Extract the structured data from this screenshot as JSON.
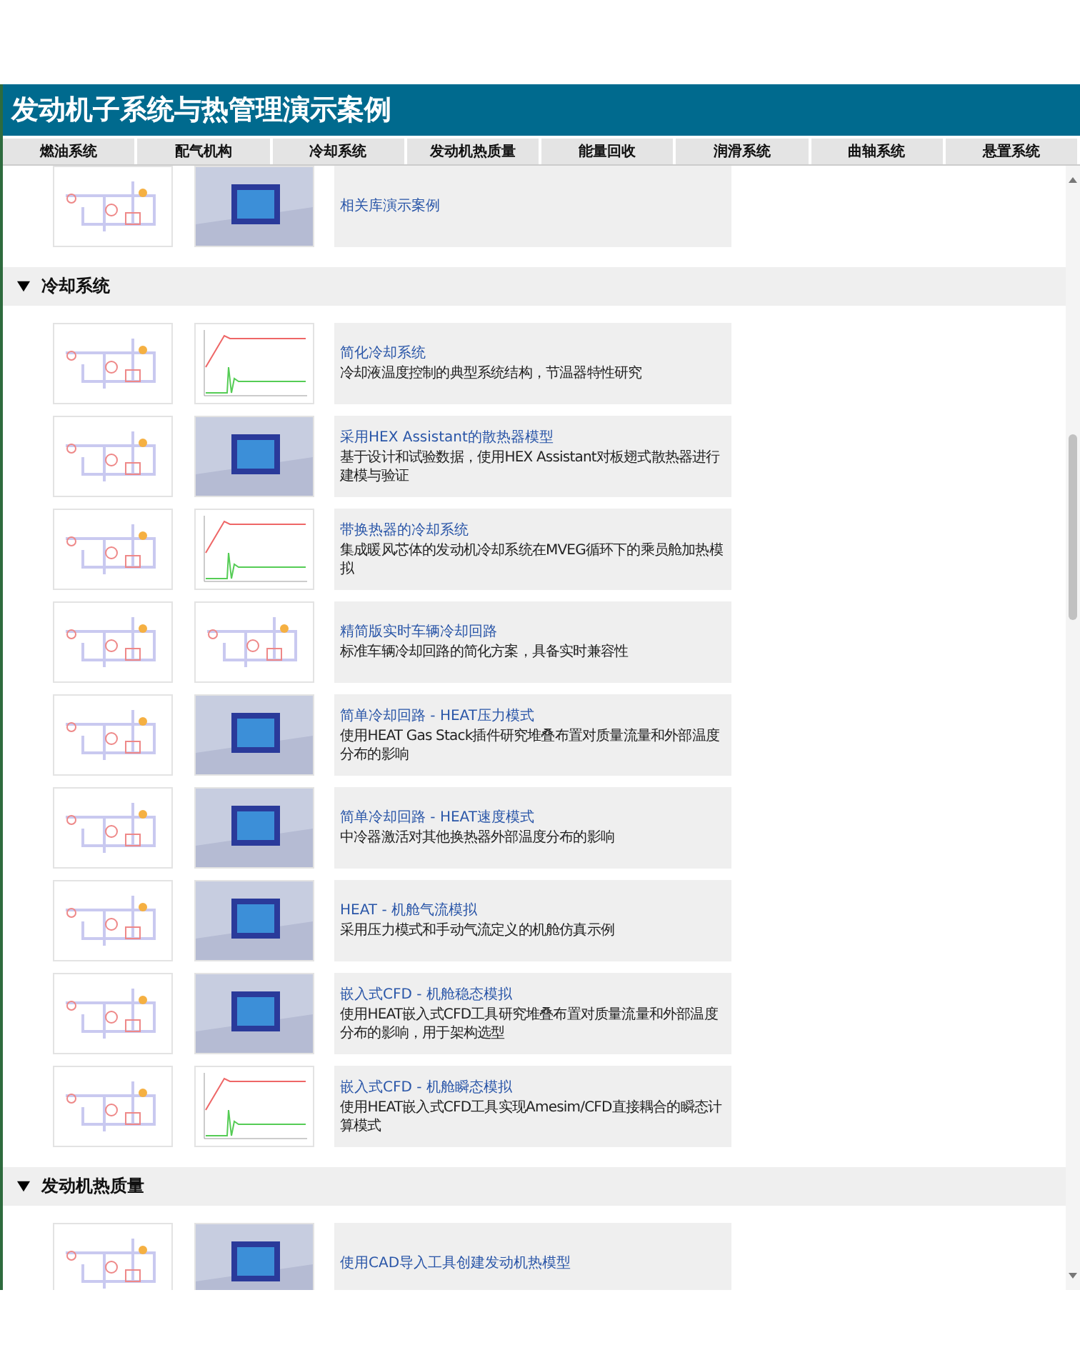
{
  "header": {
    "title": "发动机子系统与热管理演示案例"
  },
  "tabs": [
    {
      "label": "燃油系统"
    },
    {
      "label": "配气机构"
    },
    {
      "label": "冷却系统"
    },
    {
      "label": "发动机热质量"
    },
    {
      "label": "能量回收"
    },
    {
      "label": "润滑系统"
    },
    {
      "label": "曲轴系统"
    },
    {
      "label": "悬置系统"
    }
  ],
  "sections": [
    {
      "items": [
        {
          "title": "相关库演示案例",
          "thumbnails": [
            {
              "kind": "diagram"
            },
            {
              "kind": "render"
            }
          ]
        }
      ]
    },
    {
      "title": "冷却系统",
      "expanded": true,
      "items": [
        {
          "title": "简化冷却系统",
          "description": "冷却液温度控制的典型系统结构，节温器特性研究",
          "thumbnails": [
            {
              "kind": "diagram"
            },
            {
              "kind": "plot"
            }
          ]
        },
        {
          "title": "采用HEX Assistant的散热器模型",
          "description": "基于设计和试验数据，使用HEX Assistant对板翅式散热器进行建模与验证",
          "thumbnails": [
            {
              "kind": "diagram"
            },
            {
              "kind": "render"
            }
          ]
        },
        {
          "title": "带换热器的冷却系统",
          "description": "集成暖风芯体的发动机冷却系统在MVEG循环下的乘员舱加热模拟",
          "thumbnails": [
            {
              "kind": "diagram"
            },
            {
              "kind": "plot"
            }
          ]
        },
        {
          "title": "精简版实时车辆冷却回路",
          "description": "标准车辆冷却回路的简化方案，具备实时兼容性",
          "thumbnails": [
            {
              "kind": "diagram"
            },
            {
              "kind": "diagram"
            }
          ]
        },
        {
          "title": "简单冷却回路 - HEAT压力模式",
          "description": "使用HEAT Gas Stack插件研究堆叠布置对质量流量和外部温度分布的影响",
          "thumbnails": [
            {
              "kind": "diagram"
            },
            {
              "kind": "render"
            }
          ]
        },
        {
          "title": "简单冷却回路 - HEAT速度模式",
          "description": "中冷器激活对其他换热器外部温度分布的影响",
          "thumbnails": [
            {
              "kind": "diagram"
            },
            {
              "kind": "render"
            }
          ]
        },
        {
          "title": "HEAT - 机舱气流模拟",
          "description": "采用压力模式和手动气流定义的机舱仿真示例",
          "thumbnails": [
            {
              "kind": "diagram"
            },
            {
              "kind": "render"
            }
          ]
        },
        {
          "title": "嵌入式CFD - 机舱稳态模拟",
          "description": "使用HEAT嵌入式CFD工具研究堆叠布置对质量流量和外部温度分布的影响，用于架构选型",
          "thumbnails": [
            {
              "kind": "diagram"
            },
            {
              "kind": "render"
            }
          ]
        },
        {
          "title": "嵌入式CFD - 机舱瞬态模拟",
          "description": "使用HEAT嵌入式CFD工具实现Amesim/CFD直接耦合的瞬态计算模式",
          "thumbnails": [
            {
              "kind": "diagram"
            },
            {
              "kind": "plot"
            }
          ]
        }
      ]
    },
    {
      "title": "发动机热质量",
      "expanded": true,
      "items": [
        {
          "title": "使用CAD导入工具创建发动机热模型",
          "thumbnails": [
            {
              "kind": "diagram"
            },
            {
              "kind": "render"
            }
          ]
        }
      ]
    }
  ]
}
